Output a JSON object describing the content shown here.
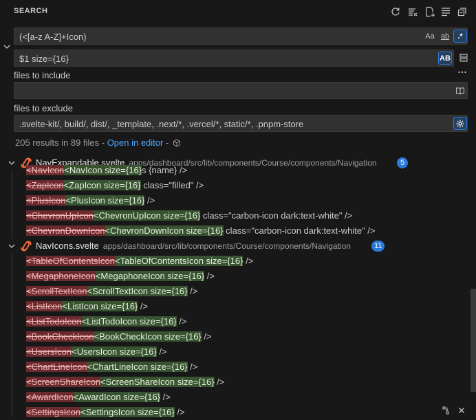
{
  "title": "SEARCH",
  "toolbar": {
    "icons": [
      "refresh-icon",
      "clear-results-icon",
      "new-search-editor-icon",
      "view-as-tree-icon",
      "collapse-all-icon"
    ]
  },
  "search": {
    "query": "(<[a-z A-Z]+Icon)",
    "match_case_label": "Aa",
    "whole_word_label": "ab",
    "regex_label": ".*",
    "replace_value": "$1 size={16}",
    "preserve_case_label": "AB",
    "include_label": "files to include",
    "include_value": "",
    "exclude_label": "files to exclude",
    "exclude_value": ".svelte-kit/, build/, dist/, _template, .next/*, .vercel/*, static/*, .pnpm-store"
  },
  "summary": {
    "text": "205 results in 89 files - ",
    "open_editor": "Open in editor",
    "sep": " - "
  },
  "files": [
    {
      "name": "NavExpandable.svelte",
      "path": "apps/dashboard/src/lib/components/Course/components/Navigation",
      "count": "5",
      "matches": [
        {
          "del": "<NavIcon",
          "ins": "<NavIcon size={16}",
          "rest": "s {name} />"
        },
        {
          "del": "<ZapIcon",
          "ins": "<ZapIcon size={16}",
          "rest": " class=\"filled\" />"
        },
        {
          "del": "<PlusIcon",
          "ins": "<PlusIcon size={16}",
          "rest": " />"
        },
        {
          "del": "<ChevronUpIcon",
          "ins": "<ChevronUpIcon size={16}",
          "rest": " class=\"carbon-icon dark:text-white\" />"
        },
        {
          "del": "<ChevronDownIcon",
          "ins": "<ChevronDownIcon size={16}",
          "rest": " class=\"carbon-icon dark:text-white\" />"
        }
      ]
    },
    {
      "name": "NavIcons.svelte",
      "path": "apps/dashboard/src/lib/components/Course/components/Navigation",
      "count": "11",
      "matches": [
        {
          "del": "<TableOfContentsIcon",
          "ins": "<TableOfContentsIcon size={16}",
          "rest": " />"
        },
        {
          "del": "<MegaphoneIcon",
          "ins": "<MegaphoneIcon size={16}",
          "rest": " />"
        },
        {
          "del": "<ScrollTextIcon",
          "ins": "<ScrollTextIcon size={16}",
          "rest": " />"
        },
        {
          "del": "<ListIcon",
          "ins": "<ListIcon size={16}",
          "rest": " />"
        },
        {
          "del": "<ListTodoIcon",
          "ins": "<ListTodoIcon size={16}",
          "rest": " />"
        },
        {
          "del": "<BookCheckIcon",
          "ins": "<BookCheckIcon size={16}",
          "rest": " />"
        },
        {
          "del": "<UsersIcon",
          "ins": "<UsersIcon size={16}",
          "rest": " />"
        },
        {
          "del": "<ChartLineIcon",
          "ins": "<ChartLineIcon size={16}",
          "rest": " />"
        },
        {
          "del": "<ScreenShareIcon",
          "ins": "<ScreenShareIcon size={16}",
          "rest": " />"
        },
        {
          "del": "<AwardIcon",
          "ins": "<AwardIcon size={16}",
          "rest": " />"
        },
        {
          "del": "<SettingsIcon",
          "ins": "<SettingsIcon size={16}",
          "rest": " />"
        }
      ]
    }
  ],
  "colors": {
    "background": "#181818",
    "input_bg": "#313131",
    "accent": "#2b79d8",
    "deleted_bg": "#6b2a2e",
    "inserted_bg": "#37532f",
    "link": "#4daafc"
  }
}
